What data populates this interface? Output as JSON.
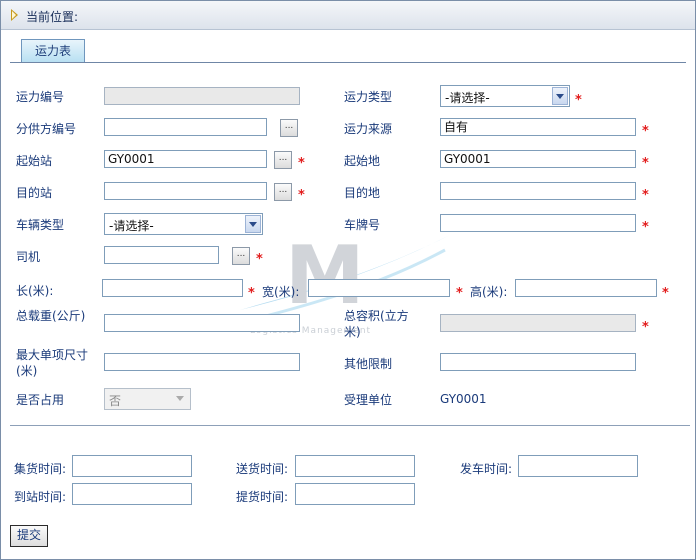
{
  "header": {
    "location_label": "当前位置:"
  },
  "tab": {
    "label": "运力表"
  },
  "fields": {
    "capacity_no": {
      "label": "运力编号",
      "value": ""
    },
    "capacity_type": {
      "label": "运力类型",
      "value": "-请选择-"
    },
    "supplier_no": {
      "label": "分供方编号",
      "value": ""
    },
    "capacity_source": {
      "label": "运力来源",
      "value": "自有"
    },
    "start_station": {
      "label": "起始站",
      "value": "GY0001"
    },
    "start_place": {
      "label": "起始地",
      "value": "GY0001"
    },
    "dest_station": {
      "label": "目的站",
      "value": ""
    },
    "dest_place": {
      "label": "目的地",
      "value": ""
    },
    "vehicle_type": {
      "label": "车辆类型",
      "value": "-请选择-"
    },
    "plate_no": {
      "label": "车牌号",
      "value": ""
    },
    "driver": {
      "label": "司机",
      "value": ""
    },
    "length": {
      "label": "长(米):",
      "value": ""
    },
    "width": {
      "label": "宽(米):",
      "value": ""
    },
    "height": {
      "label": "高(米):",
      "value": ""
    },
    "total_weight": {
      "label": "总载重(公斤)",
      "value": ""
    },
    "total_volume": {
      "label": "总容积(立方米)",
      "value": ""
    },
    "max_item_size": {
      "label": "最大单项尺寸(米)",
      "value": ""
    },
    "other_limit": {
      "label": "其他限制",
      "value": ""
    },
    "is_occupied": {
      "label": "是否占用",
      "value": "否"
    },
    "handling_unit": {
      "label": "受理单位",
      "value": "GY0001"
    }
  },
  "times": {
    "collect": {
      "label": "集货时间:",
      "value": ""
    },
    "delivery": {
      "label": "送货时间:",
      "value": ""
    },
    "departure": {
      "label": "发车时间:",
      "value": ""
    },
    "arrival": {
      "label": "到站时间:",
      "value": ""
    },
    "pickup": {
      "label": "提货时间:",
      "value": ""
    }
  },
  "common": {
    "browse": "...",
    "required": "*"
  },
  "submit_label": "提交",
  "watermark": {
    "letter": "M",
    "text": "Logistics Management"
  }
}
